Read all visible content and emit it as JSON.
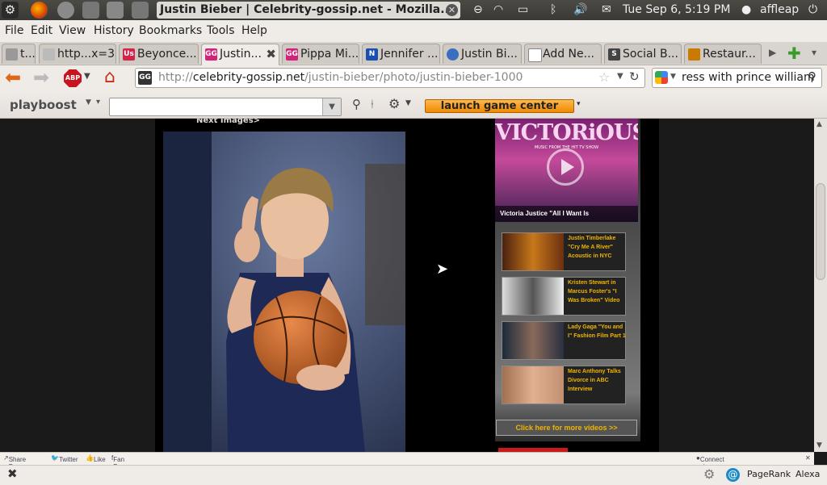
{
  "panel": {
    "window_title": "Justin Bieber | Celebrity-gossip.net - Mozilla...",
    "clock": "Tue Sep  6,  5:19 PM",
    "user": "affleap"
  },
  "menu": [
    "File",
    "Edit",
    "View",
    "History",
    "Bookmarks",
    "Tools",
    "Help"
  ],
  "tabs": [
    {
      "label": "t...",
      "fav": "",
      "color": "#888"
    },
    {
      "label": "http...x=3",
      "fav": "",
      "color": "#999"
    },
    {
      "label": "Beyonce...",
      "fav": "Us",
      "color": "#d2234a"
    },
    {
      "label": "Justin...",
      "fav": "GG",
      "color": "#d2237a",
      "active": true
    },
    {
      "label": "Pippa Mi...",
      "fav": "GG",
      "color": "#d2237a"
    },
    {
      "label": "Jennifer ...",
      "fav": "N",
      "color": "#1a4fb0"
    },
    {
      "label": "Justin Bi...",
      "fav": "",
      "color": "#3a6fc0"
    },
    {
      "label": "Add Ne...",
      "fav": "",
      "color": "#999"
    },
    {
      "label": "Social B...",
      "fav": "S",
      "color": "#444"
    },
    {
      "label": "Restaur...",
      "fav": "",
      "color": "#c97a00"
    }
  ],
  "nav": {
    "url_prefix": "http://",
    "url_domain": "celebrity-gossip.net",
    "url_path": "/justin-bieber/photo/justin-bieber-1000",
    "search_value": "ress with prince william"
  },
  "toolbar": {
    "brand": "playboost",
    "search_placeholder": "",
    "game_button": "launch game center"
  },
  "page": {
    "next_images": "Next Images>",
    "video_brand": "VICTORiOUS",
    "video_subtitle": "MUSIC FROM THE HIT TV SHOW",
    "video_caption": "Victoria Justice \"All I Want Is",
    "videos": [
      {
        "title": "Justin Timberlake \"Cry Me A River\" Acoustic in NYC"
      },
      {
        "title": "Kristen Stewart in Marcus Foster's \"I Was Broken\" Video"
      },
      {
        "title": "Lady Gaga \"You and I\" Fashion Film Part 1"
      },
      {
        "title": "Marc Anthony Talks Divorce in ABC Interview"
      }
    ],
    "more_videos": "Click here for more videos >>"
  },
  "addon": {
    "share": "Share Page",
    "twitter": "Twitter",
    "like": "Like",
    "fanpage": "Fan Page",
    "meebo": "Connect via Meebo"
  },
  "status": {
    "pagerank": "PageRank",
    "alexa": "Alexa"
  }
}
